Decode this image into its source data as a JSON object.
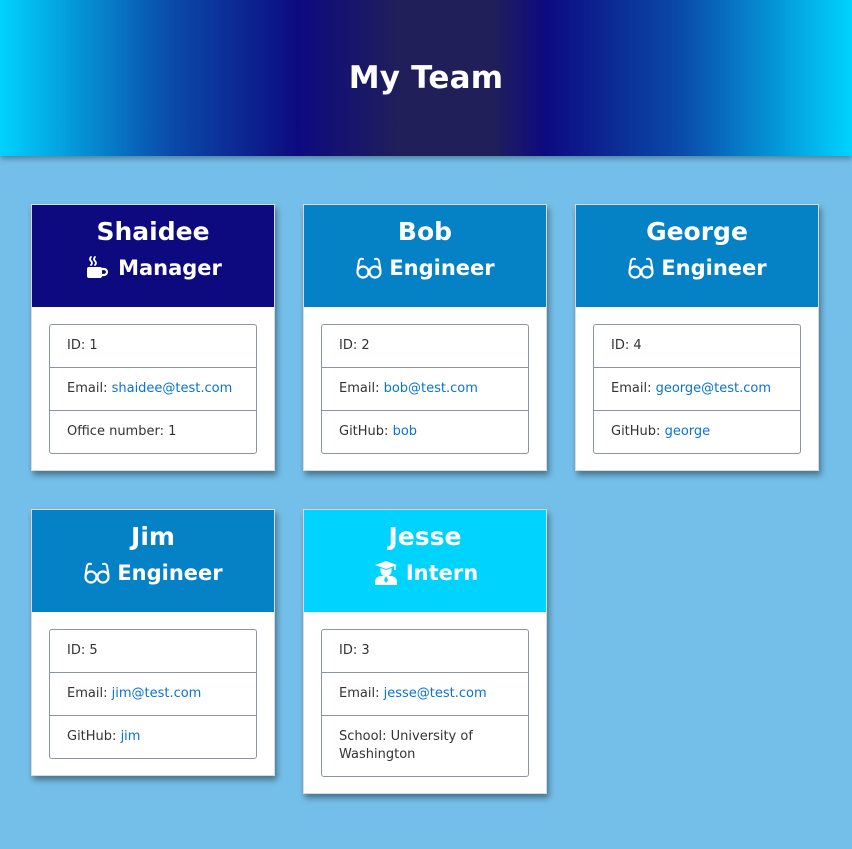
{
  "header": {
    "title": "My Team"
  },
  "cards": [
    {
      "name": "Shaidee",
      "role": "Manager",
      "icon": "coffee-icon",
      "id_text": "ID: 1",
      "email_label": "Email: ",
      "email": "shaidee@test.com",
      "extra_label": "Office number: 1",
      "extra_link": ""
    },
    {
      "name": "Bob",
      "role": "Engineer",
      "icon": "glasses-icon",
      "id_text": "ID: 2",
      "email_label": "Email: ",
      "email": "bob@test.com",
      "extra_label": "GitHub: ",
      "extra_link": "bob"
    },
    {
      "name": "George",
      "role": "Engineer",
      "icon": "glasses-icon",
      "id_text": "ID: 4",
      "email_label": "Email: ",
      "email": "george@test.com",
      "extra_label": "GitHub: ",
      "extra_link": "george"
    },
    {
      "name": "Jim",
      "role": "Engineer",
      "icon": "glasses-icon",
      "id_text": "ID: 5",
      "email_label": "Email: ",
      "email": "jim@test.com",
      "extra_label": "GitHub: ",
      "extra_link": "jim"
    },
    {
      "name": "Jesse",
      "role": "Intern",
      "icon": "graduate-icon",
      "id_text": "ID: 3",
      "email_label": "Email: ",
      "email": "jesse@test.com",
      "extra_label": "School: University of Washington",
      "extra_link": ""
    }
  ],
  "colors": {
    "manager": "#0d0a80",
    "engineer": "#0581c6",
    "intern": "#00d3fd",
    "page_background": "#74bfe9",
    "link": "#0a72d6"
  }
}
